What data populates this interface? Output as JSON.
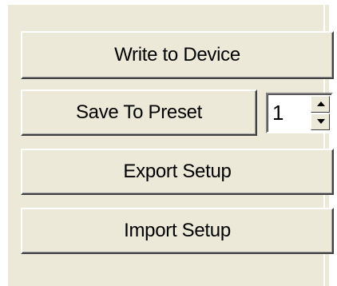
{
  "buttons": {
    "write_label": "Write to Device",
    "save_label": "Save To Preset",
    "export_label": "Export Setup",
    "import_label": "Import Setup"
  },
  "preset_spinner": {
    "value": "1",
    "up_icon": "spin-up-arrow-icon",
    "down_icon": "spin-down-arrow-icon"
  },
  "colors": {
    "panel_background": "#ece9d8",
    "text": "#000000"
  }
}
